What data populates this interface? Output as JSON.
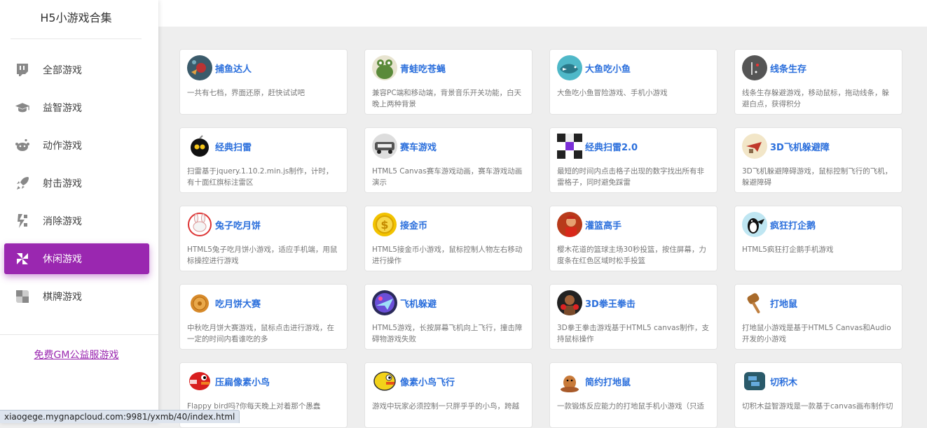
{
  "app": {
    "title": "H5小游戏合集"
  },
  "sidebar": {
    "items": [
      {
        "label": "全部游戏",
        "icon": "twitch-icon"
      },
      {
        "label": "益智游戏",
        "icon": "graduation-cap-icon"
      },
      {
        "label": "动作游戏",
        "icon": "reddit-alien-icon"
      },
      {
        "label": "射击游戏",
        "icon": "rocket-icon"
      },
      {
        "label": "消除游戏",
        "icon": "bolt-blocks-icon"
      },
      {
        "label": "休闲游戏",
        "icon": "pinwheel-icon",
        "active": true
      },
      {
        "label": "棋牌游戏",
        "icon": "checker-icon"
      }
    ],
    "gm_link": "免费GM公益服游戏"
  },
  "colors": {
    "accent": "#9a27b0",
    "title_link": "#2b6fdc"
  },
  "games": [
    {
      "name": "捕鱼达人",
      "desc": "一共有七档，界面还原，赶快试试吧",
      "thumb": "fish-hunter-thumb"
    },
    {
      "name": "青蛙吃苍蝇",
      "desc": "兼容PC端和移动端，背景音乐开关功能，白天晚上两种背景",
      "thumb": "frog-thumb"
    },
    {
      "name": "大鱼吃小鱼",
      "desc": "大鱼吃小鱼冒险游戏、手机小游戏",
      "thumb": "big-fish-thumb"
    },
    {
      "name": "线条生存",
      "desc": "线条生存躲避游戏，移动鼠标，拖动线条，躲避白点，获得积分",
      "thumb": "line-survival-thumb"
    },
    {
      "name": "经典扫雷",
      "desc": "扫雷基于jquery.1.10.2.min.js制作，计时，有十面红旗标注雷区",
      "thumb": "bomb-thumb"
    },
    {
      "name": "赛车游戏",
      "desc": "HTML5 Canvas赛车游戏动画，赛车游戏动画演示",
      "thumb": "car-thumb"
    },
    {
      "name": "经典扫雷2.0",
      "desc": "最短的时间内点击格子出现的数字找出所有非雷格子，同时避免踩雷",
      "thumb": "minesweeper2-thumb"
    },
    {
      "name": "3D飞机躲避障",
      "desc": "3D飞机躲避障碍游戏，鼠标控制飞行的飞机，躲避障碍",
      "thumb": "plane3d-thumb"
    },
    {
      "name": "兔子吃月饼",
      "desc": "HTML5兔子吃月饼小游戏，适应手机端，用鼠标操控进行游戏",
      "thumb": "rabbit-thumb"
    },
    {
      "name": "接金币",
      "desc": "HTML5接金币小游戏，鼠标控制人物左右移动进行操作",
      "thumb": "coin-thumb"
    },
    {
      "name": "灌篮高手",
      "desc": "樱木花道的篮球主场30秒投篮，按住屏幕，力度条在红色区域时松手投篮",
      "thumb": "basketball-thumb"
    },
    {
      "name": "疯狂打企鹅",
      "desc": "HTML5疯狂打企鹅手机游戏",
      "thumb": "penguin-thumb"
    },
    {
      "name": "吃月饼大赛",
      "desc": "中秋吃月饼大赛游戏，鼠标点击进行游戏，在一定的时间内看谁吃的多",
      "thumb": "mooncake-thumb"
    },
    {
      "name": "飞机躲避",
      "desc": "HTML5游戏，长按屏幕飞机向上飞行，撞击障碍物游戏失败",
      "thumb": "plane-thumb"
    },
    {
      "name": "3D拳王拳击",
      "desc": "3D拳王拳击游戏基于HTML5 canvas制作，支持鼠标操作",
      "thumb": "boxer-thumb"
    },
    {
      "name": "打地鼠",
      "desc": "打地鼠小游戏是基于HTML5 Canvas和Audio开发的小游戏",
      "thumb": "hammer-thumb"
    },
    {
      "name": "压扁像素小鸟",
      "desc": "Flappy bird吗?你每天晚上对着那个愚蠢",
      "thumb": "flappy-red-thumb"
    },
    {
      "name": "像素小鸟飞行",
      "desc": "游戏中玩家必须控制一只胖乎乎的小鸟，跨越",
      "thumb": "flappy-yellow-thumb"
    },
    {
      "name": "简约打地鼠",
      "desc": "一款锻炼反应能力的打地鼠手机小游戏（只适",
      "thumb": "mole-thumb"
    },
    {
      "name": "切积木",
      "desc": "切积木益智游戏是一款基于canvas画布制作切",
      "thumb": "blocks-thumb"
    }
  ],
  "status_url": "xiaogege.mygnapcloud.com:9981/yxmb/40/index.html"
}
